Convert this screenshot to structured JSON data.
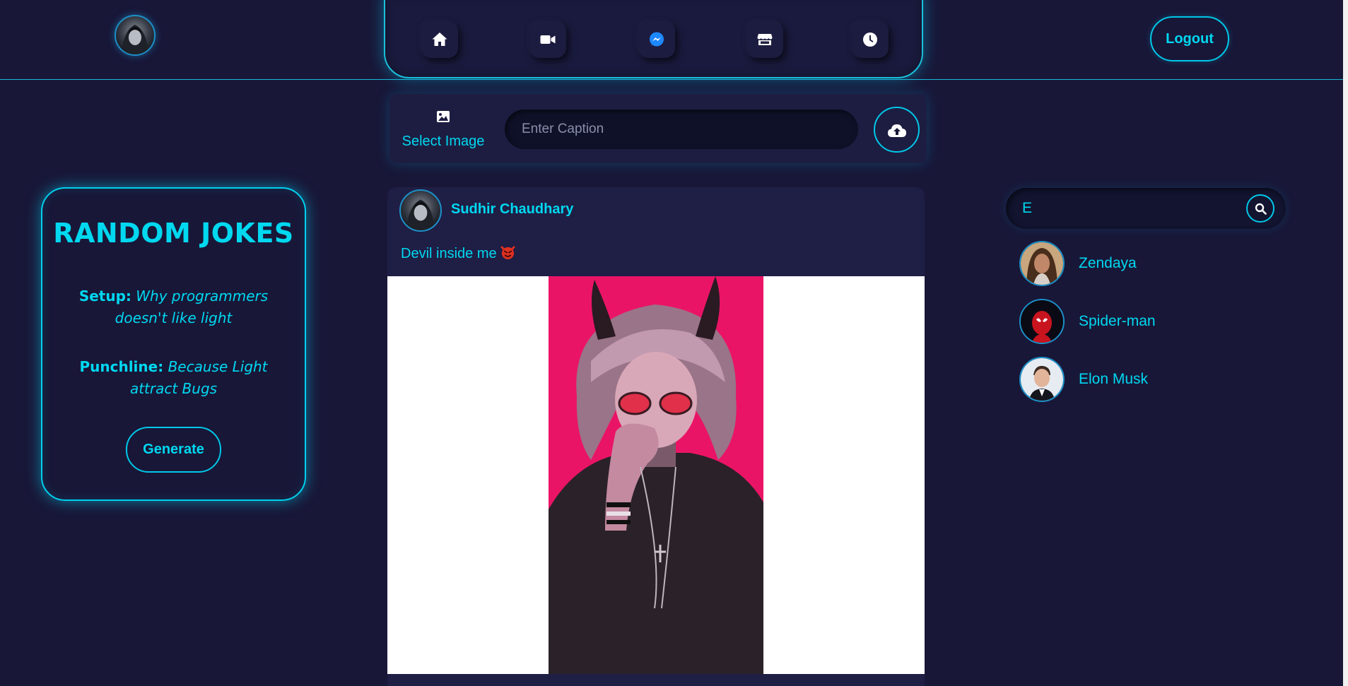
{
  "header": {
    "nav_icons": [
      "home-icon",
      "video-icon",
      "messenger-icon",
      "store-icon",
      "clock-icon"
    ],
    "logout_label": "Logout"
  },
  "upload": {
    "select_image_label": "Select Image",
    "caption_placeholder": "Enter Caption",
    "caption_value": ""
  },
  "jokes": {
    "title": "RANDOM JOKES",
    "setup_label": "Setup:",
    "setup_text": "Why programmers doesn't like light",
    "punchline_label": "Punchline:",
    "punchline_text": "Because Light attract Bugs",
    "generate_label": "Generate"
  },
  "post": {
    "author": "Sudhir Chaudhary",
    "caption": "Devil inside me",
    "caption_emoji": "devil-emoji"
  },
  "search": {
    "value": "E"
  },
  "contacts": [
    {
      "name": "Zendaya"
    },
    {
      "name": "Spider-man"
    },
    {
      "name": "Elon Musk"
    }
  ],
  "colors": {
    "background": "#181738",
    "accent": "#00d8f0",
    "card": "#1f1e45",
    "post_image_bg": "#ea1466"
  }
}
